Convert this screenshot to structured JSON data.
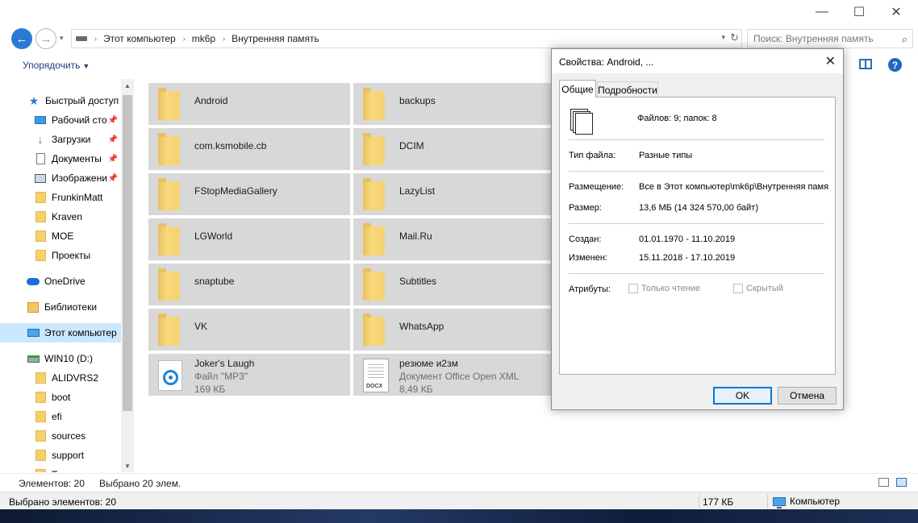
{
  "window": {
    "controls": {
      "minimize": "—",
      "maximize": "☐",
      "close": "✕"
    }
  },
  "address": {
    "crumbs": [
      "Этот компьютер",
      "mk6p",
      "Внутренняя память"
    ],
    "separator": "›",
    "search_placeholder": "Поиск: Внутренняя память"
  },
  "toolbar": {
    "organize_label": "Упорядочить"
  },
  "navpane": {
    "items": [
      {
        "label": "Быстрый доступ",
        "icon": "star-icon",
        "pinned": false
      },
      {
        "label": "Рабочий сто",
        "icon": "desktop-icon",
        "pinned": true
      },
      {
        "label": "Загрузки",
        "icon": "download-icon",
        "pinned": true
      },
      {
        "label": "Документы",
        "icon": "documents-icon",
        "pinned": true
      },
      {
        "label": "Изображени",
        "icon": "pictures-icon",
        "pinned": true
      },
      {
        "label": "FrunkinMatt",
        "icon": "folder-icon",
        "pinned": false
      },
      {
        "label": "Kraven",
        "icon": "folder-icon",
        "pinned": false
      },
      {
        "label": "MOE",
        "icon": "folder-icon",
        "pinned": false
      },
      {
        "label": "Проекты",
        "icon": "folder-icon",
        "pinned": false
      },
      {
        "label": "OneDrive",
        "icon": "cloud-icon",
        "pinned": false
      },
      {
        "label": "Библиотеки",
        "icon": "library-icon",
        "pinned": false
      },
      {
        "label": "Этот компьютер",
        "icon": "computer-icon",
        "pinned": false,
        "selected": true
      },
      {
        "label": "WIN10 (D:)",
        "icon": "drive-icon",
        "pinned": false
      },
      {
        "label": "ALIDVRS2",
        "icon": "folder-icon",
        "pinned": false
      },
      {
        "label": "boot",
        "icon": "folder-icon",
        "pinned": false
      },
      {
        "label": "efi",
        "icon": "folder-icon",
        "pinned": false
      },
      {
        "label": "sources",
        "icon": "folder-icon",
        "pinned": false
      },
      {
        "label": "support",
        "icon": "folder-icon",
        "pinned": false
      },
      {
        "label": "T",
        "icon": "folder-icon",
        "pinned": false
      }
    ]
  },
  "content": {
    "tiles": [
      {
        "name": "Android",
        "kind": "folder"
      },
      {
        "name": "backups",
        "kind": "folder"
      },
      {
        "name": "com.ksmobile.cb",
        "kind": "folder"
      },
      {
        "name": "DCIM",
        "kind": "folder"
      },
      {
        "name": "FStopMediaGallery",
        "kind": "folder"
      },
      {
        "name": "LazyList",
        "kind": "folder"
      },
      {
        "name": "LGWorld",
        "kind": "folder"
      },
      {
        "name": "Mail.Ru",
        "kind": "folder"
      },
      {
        "name": "snaptube",
        "kind": "folder"
      },
      {
        "name": "Subtitles",
        "kind": "folder"
      },
      {
        "name": "VK",
        "kind": "folder"
      },
      {
        "name": "WhatsApp",
        "kind": "folder"
      },
      {
        "name": "Joker's Laugh",
        "kind": "mp3",
        "type": "Файл \"MP3\"",
        "size": "169 КБ"
      },
      {
        "name": "резюме и2зм",
        "kind": "docx",
        "type": "Документ Office Open XML",
        "size": "8,49 КБ",
        "icon_tag": "DOCX"
      }
    ]
  },
  "status": {
    "items_count": "Элементов: 20",
    "selected_count": "Выбрано 20 элем.",
    "selected_items": "Выбрано элементов: 20",
    "size": "177 КБ",
    "location": "Компьютер"
  },
  "dialog": {
    "title": "Свойства: Android, ...",
    "close": "✕",
    "tabs": [
      "Общие",
      "Подробности"
    ],
    "summary": "Файлов: 9; папок: 8",
    "type_label": "Тип файла:",
    "type_value": "Разные типы",
    "location_label": "Размещение:",
    "location_value": "Все в Этот компьютер\\mk6p\\Внутренняя памя",
    "size_label": "Размер:",
    "size_value": "13,6 МБ (14 324 570,00 байт)",
    "created_label": "Создан:",
    "created_value": "01.01.1970 - 11.10.2019",
    "modified_label": "Изменен:",
    "modified_value": "15.11.2018 - 17.10.2019",
    "attributes_label": "Атрибуты:",
    "readonly_label": "Только чтение",
    "hidden_label": "Скрытый",
    "ok_label": "OK",
    "cancel_label": "Отмена"
  }
}
